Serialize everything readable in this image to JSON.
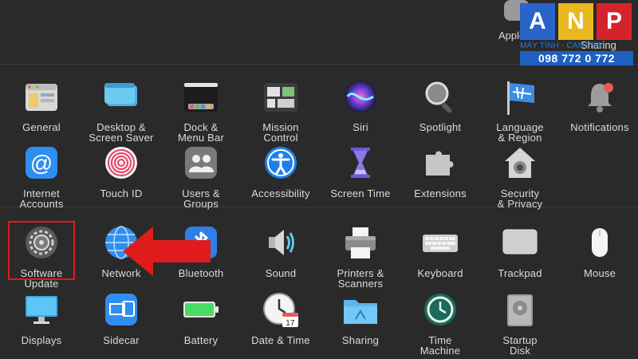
{
  "top_row": {
    "apple_id_label": "Apple",
    "sharing_label": "Sharing"
  },
  "logo": {
    "letters": [
      "A",
      "N",
      "P"
    ],
    "subtitle": "MÁY TÍNH - CAMERA",
    "phone": "098 772 0 772"
  },
  "rows": [
    [
      {
        "label": "General",
        "icon": "general-icon"
      },
      {
        "label": "Desktop &\nScreen Saver",
        "icon": "desktop-icon"
      },
      {
        "label": "Dock &\nMenu Bar",
        "icon": "dock-icon"
      },
      {
        "label": "Mission\nControl",
        "icon": "mission-control-icon"
      },
      {
        "label": "Siri",
        "icon": "siri-icon"
      },
      {
        "label": "Spotlight",
        "icon": "spotlight-icon"
      },
      {
        "label": "Language\n& Region",
        "icon": "language-flag-icon"
      },
      {
        "label": "Notifications",
        "icon": "bell-icon"
      }
    ],
    [
      {
        "label": "Internet\nAccounts",
        "icon": "at-sign-icon"
      },
      {
        "label": "Touch ID",
        "icon": "fingerprint-icon"
      },
      {
        "label": "Users &\nGroups",
        "icon": "users-icon"
      },
      {
        "label": "Accessibility",
        "icon": "accessibility-icon"
      },
      {
        "label": "Screen Time",
        "icon": "hourglass-icon"
      },
      {
        "label": "Extensions",
        "icon": "puzzle-icon"
      },
      {
        "label": "Security\n& Privacy",
        "icon": "house-lock-icon"
      }
    ],
    [
      {
        "label": "Software\nUpdate",
        "icon": "gear-icon"
      },
      {
        "label": "Network",
        "icon": "globe-icon"
      },
      {
        "label": "Bluetooth",
        "icon": "bluetooth-icon"
      },
      {
        "label": "Sound",
        "icon": "speaker-icon"
      },
      {
        "label": "Printers &\nScanners",
        "icon": "printer-icon"
      },
      {
        "label": "Keyboard",
        "icon": "keyboard-icon"
      },
      {
        "label": "Trackpad",
        "icon": "trackpad-icon"
      },
      {
        "label": "Mouse",
        "icon": "mouse-icon"
      }
    ],
    [
      {
        "label": "Displays",
        "icon": "display-icon"
      },
      {
        "label": "Sidecar",
        "icon": "sidecar-icon"
      },
      {
        "label": "Battery",
        "icon": "battery-icon"
      },
      {
        "label": "Date & Time",
        "icon": "calendar-clock-icon"
      },
      {
        "label": "Sharing",
        "icon": "folder-icon"
      },
      {
        "label": "Time\nMachine",
        "icon": "time-machine-icon"
      },
      {
        "label": "Startup\nDisk",
        "icon": "disk-icon"
      }
    ]
  ],
  "annotations": {
    "highlighted_item": "Software Update",
    "highlight_color": "#e01b1b",
    "arrow_color": "#e01b1b"
  }
}
